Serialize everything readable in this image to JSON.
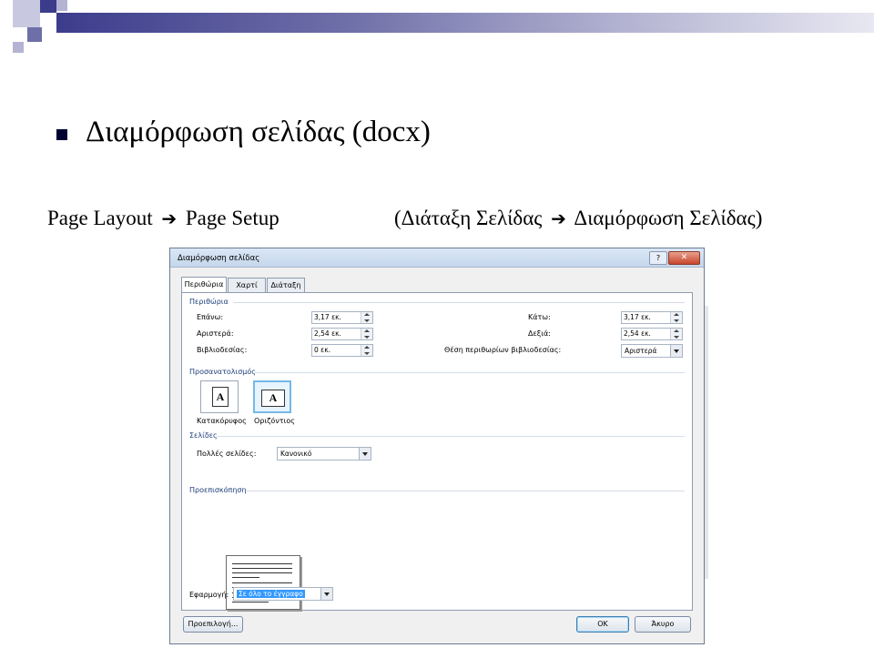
{
  "slide": {
    "title": "Διαμόρφωση σελίδας (docx)",
    "subtitle_left_a": "Page Layout",
    "subtitle_left_b": "Page Setup",
    "subtitle_right_a": "(Διάταξη Σελίδας",
    "subtitle_right_b": "Διαμόρφωση Σελίδας)",
    "arrow_glyph": "➔",
    "bullet_color": "#000033"
  },
  "dialog": {
    "title": "Διαμόρφωση σελίδας",
    "help_label": "?",
    "close_label": "✕",
    "tabs": [
      {
        "label": "Περιθώρια",
        "active": true
      },
      {
        "label": "Χαρτί",
        "active": false
      },
      {
        "label": "Διάταξη",
        "active": false
      }
    ],
    "margins_group": "Περιθώρια",
    "margins": {
      "top_label": "Επάνω:",
      "top_value": "3,17 εκ.",
      "left_label": "Αριστερά:",
      "left_value": "2,54 εκ.",
      "gutter_label": "Βιβλιοδεσίας:",
      "gutter_value": "0 εκ.",
      "bottom_label": "Κάτω:",
      "bottom_value": "3,17 εκ.",
      "right_label": "Δεξιά:",
      "right_value": "2,54 εκ.",
      "gutter_pos_label": "Θέση περιθωρίων βιβλιοδεσίας:",
      "gutter_pos_value": "Αριστερά"
    },
    "orientation_group": "Προσανατολισμός",
    "orientation": {
      "portrait_label": "Κατακόρυφος",
      "landscape_label": "Οριζόντιος",
      "icon_letter": "A",
      "selected": "landscape"
    },
    "pages_group": "Σελίδες",
    "pages": {
      "multiple_label": "Πολλές σελίδες:",
      "multiple_value": "Κανονικό"
    },
    "preview_group": "Προεπισκόπηση",
    "apply": {
      "label": "Εφαρμογή:",
      "value": "Σε όλο το έγγραφο"
    },
    "buttons": {
      "default_label": "Προεπιλογή...",
      "ok_label": "OK",
      "cancel_label": "Άκυρο"
    }
  }
}
